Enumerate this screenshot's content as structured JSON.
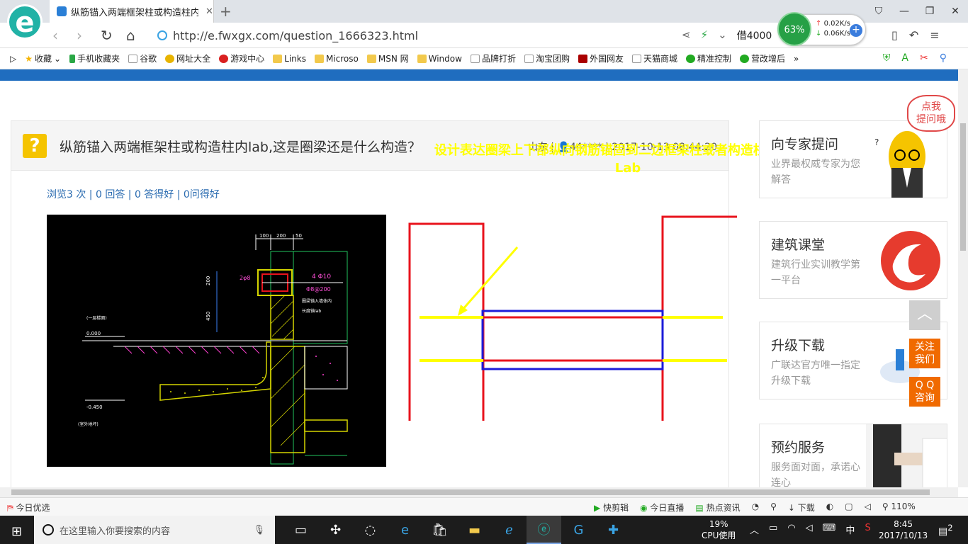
{
  "tab": {
    "title": "纵筋锚入两端框架柱或构造柱内la"
  },
  "address": {
    "url": "http://e.fwxgx.com/question_1666323.html",
    "search_hint": "借4000"
  },
  "speed": {
    "percent": "63%",
    "up": "0.02K/s",
    "down": "0.06K/s"
  },
  "bookmarks": [
    "收藏",
    "手机收藏夹",
    "谷歌",
    "网址大全",
    "游戏中心",
    "Links",
    "Microso",
    "MSN 网",
    "Window",
    "品牌打折",
    "淘宝团购",
    "外国网友",
    "天猫商城",
    "精准控制",
    "营改增后"
  ],
  "question": {
    "title": "纵筋锚入两端框架柱或构造柱内lab,这是圈梁还是什么构造？",
    "meta": "山东 | 👤44**** | 2017-10-13 08:44:20",
    "stats": "浏览3 次 | 0 回答 | 0 答得好 | 0问得好"
  },
  "cad": {
    "dims": [
      "100",
      "200",
      "50"
    ],
    "v_dims": [
      "200",
      "450"
    ],
    "label_bars": "2φ8",
    "label_main": "4 Φ10",
    "label_stir": "Φ8@200",
    "note_a": "圈梁锚入墙体内",
    "note_b": "长度锚lab",
    "left_note": "(一层楼面)",
    "elev_1": "0.000",
    "elev_2": "-0.450",
    "elev_note": "(室外地坪)"
  },
  "sketch": {
    "note": "设计表达圈梁上下部纵向钢筋锚固到二边框架柱或者构造柱 的长度为Lab",
    "colors": {
      "column": "#e8131c",
      "beam": "#1c1cd8",
      "rebar": "#ffff00"
    }
  },
  "sidebar": {
    "bubble": "点我\n提问哦",
    "cards": [
      {
        "title": "向专家提问",
        "sub": "业界最权威专家为您解答"
      },
      {
        "title": "建筑课堂",
        "sub": "建筑行业实训教学第一平台"
      },
      {
        "title": "升级下载",
        "sub": "广联达官方唯一指定升级下载"
      },
      {
        "title": "预约服务",
        "sub": "服务面对面，承诺心连心"
      }
    ],
    "follow": "关注\n我们",
    "qq": "Q Q\n咨询"
  },
  "status": {
    "left": "今日优选",
    "items": [
      "快剪辑",
      "今日直播",
      "热点资讯",
      "下载",
      "110%"
    ]
  },
  "taskbar": {
    "search_placeholder": "在这里输入你要搜索的内容",
    "cpu_pct": "19%",
    "cpu_label": "CPU使用",
    "ime": "中",
    "time": "8:45",
    "date": "2017/10/13",
    "notif_count": "2"
  }
}
